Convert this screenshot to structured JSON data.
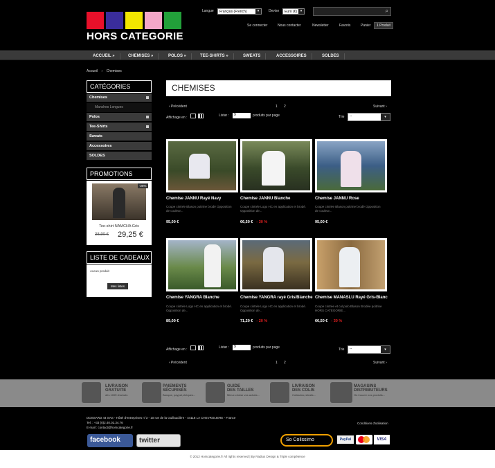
{
  "brand": {
    "name": "HORS CATEGORIE",
    "colors": [
      "#e8102a",
      "#3a2d9c",
      "#f2e600",
      "#f3a7c8",
      "#22a03a"
    ]
  },
  "header": {
    "language_label": "Langue",
    "language_value": "Français (French)",
    "currency_label": "Devise",
    "currency_value": "Euro (€)",
    "search_placeholder": "",
    "links": [
      "Se connecter",
      "Nous contacter",
      "Newsletter",
      "Favoris"
    ],
    "cart_label": "Panier",
    "cart_count": "1 Produit"
  },
  "nav": [
    "ACCUEIL »",
    "CHEMISES »",
    "POLOS »",
    "TEE-SHIRTS »",
    "SWEATS",
    "ACCESSOIRES",
    "SOLDES"
  ],
  "breadcrumb": {
    "home": "Accueil",
    "current": "Chemises",
    "sep": "›"
  },
  "sidebar": {
    "categories_title": "CATÉGORIES",
    "categories": [
      {
        "label": "Chemises",
        "sub": "Manches Longues"
      },
      {
        "label": "Polos"
      },
      {
        "label": "Tee-Shirts"
      },
      {
        "label": "Sweats"
      },
      {
        "label": "Accessoires"
      },
      {
        "label": "SOLDES"
      }
    ],
    "promotions_title": "PROMOTIONS",
    "promo": {
      "badge": "-25%",
      "name": "Tee-shirt NAMCHA Gris",
      "old_price": "38,90 €",
      "price": "29,25 €"
    },
    "gifts_title": "LISTE DE CADEAUX",
    "gifts_empty": "Aucun produit",
    "gifts_button": "Mes listes"
  },
  "main": {
    "title": "CHEMISES",
    "pager": {
      "prev": "‹ Précédent",
      "pages": [
        "1",
        "2"
      ],
      "next": "Suivant ›"
    },
    "display_label": "Affichage en :",
    "show_label": "Listar :",
    "show_value": "9",
    "per_page_label": "produits par page",
    "sort_label": "Trie",
    "sort_value": "--"
  },
  "products": [
    {
      "name": "Chemise JANNU Rayé Navy",
      "desc": "Coupe cintrée Blason poitrine brodé Opposition de couleur...",
      "price": "95,00 €",
      "discount": ""
    },
    {
      "name": "Chemise JANNU Blanche",
      "desc": "Coupe cintrée Logo HC en application et brodé. Opposition de...",
      "price": "66,50 €",
      "discount": "- 30 %"
    },
    {
      "name": "Chemise JANNU Rose",
      "desc": "Coupe cintrée Blason poitrine brodé Opposition de couleur...",
      "price": "95,00 €",
      "discount": ""
    },
    {
      "name": "Chemise YANGRA Blanche",
      "desc": "Coupe cintrée Logo HC en application et brodé. Opposition de...",
      "price": "89,00 €",
      "discount": ""
    },
    {
      "name": "Chemise YANGRA rayé Gris/Blanche",
      "desc": "Coupe cintrée Logo HC en application et brodé. Opposition de...",
      "price": "71,20 €",
      "discount": "- 20 %"
    },
    {
      "name": "Chemise MANASLU Rayé Gris-Blanc",
      "desc": "Coupe cintrée et col polo Blason Brodée poitrine HORS CATEGORIE...",
      "price": "66,50 €",
      "discount": "- 30 %"
    }
  ],
  "services": [
    {
      "title": "LIVRAISON",
      "title2": "GRATUITE",
      "sub": "dès 100€ d'achats"
    },
    {
      "title": "PAIEMENTS",
      "title2": "SÉCURISÉS",
      "sub": "Banque, paypal,chèques..."
    },
    {
      "title": "GUIDE",
      "title2": "DES TAILLES",
      "sub": "Mieux choisir vos achats..."
    },
    {
      "title": "LIVRAISON",
      "title2": "DES COLIS",
      "sub": "Colissimo,retraits..."
    },
    {
      "title": "MAGASINS",
      "title2": "DISTRIBUTEURS",
      "sub": "Où trouver nos produits..."
    }
  ],
  "footer": {
    "address": "DOSSARD 44 SAS - Hôtel d'entreprises n°3 - 10 rue de la Guillaudière - 44118 LA CHEVROLIERE - France",
    "tel": "Tel. : +33 (0)2.40.02.34.76",
    "email": "E-mail : contact@horscategorie.fr",
    "conditions": "Conditions d'utilisation",
    "facebook": "facebook",
    "twitter": "twitter",
    "payments": [
      "So Colissimo",
      "PayPal",
      "MasterCard",
      "VISA"
    ],
    "copyright": "© 2012 Horscategorie.fr All rights reserved | By Radius Design & Triple compétence"
  }
}
